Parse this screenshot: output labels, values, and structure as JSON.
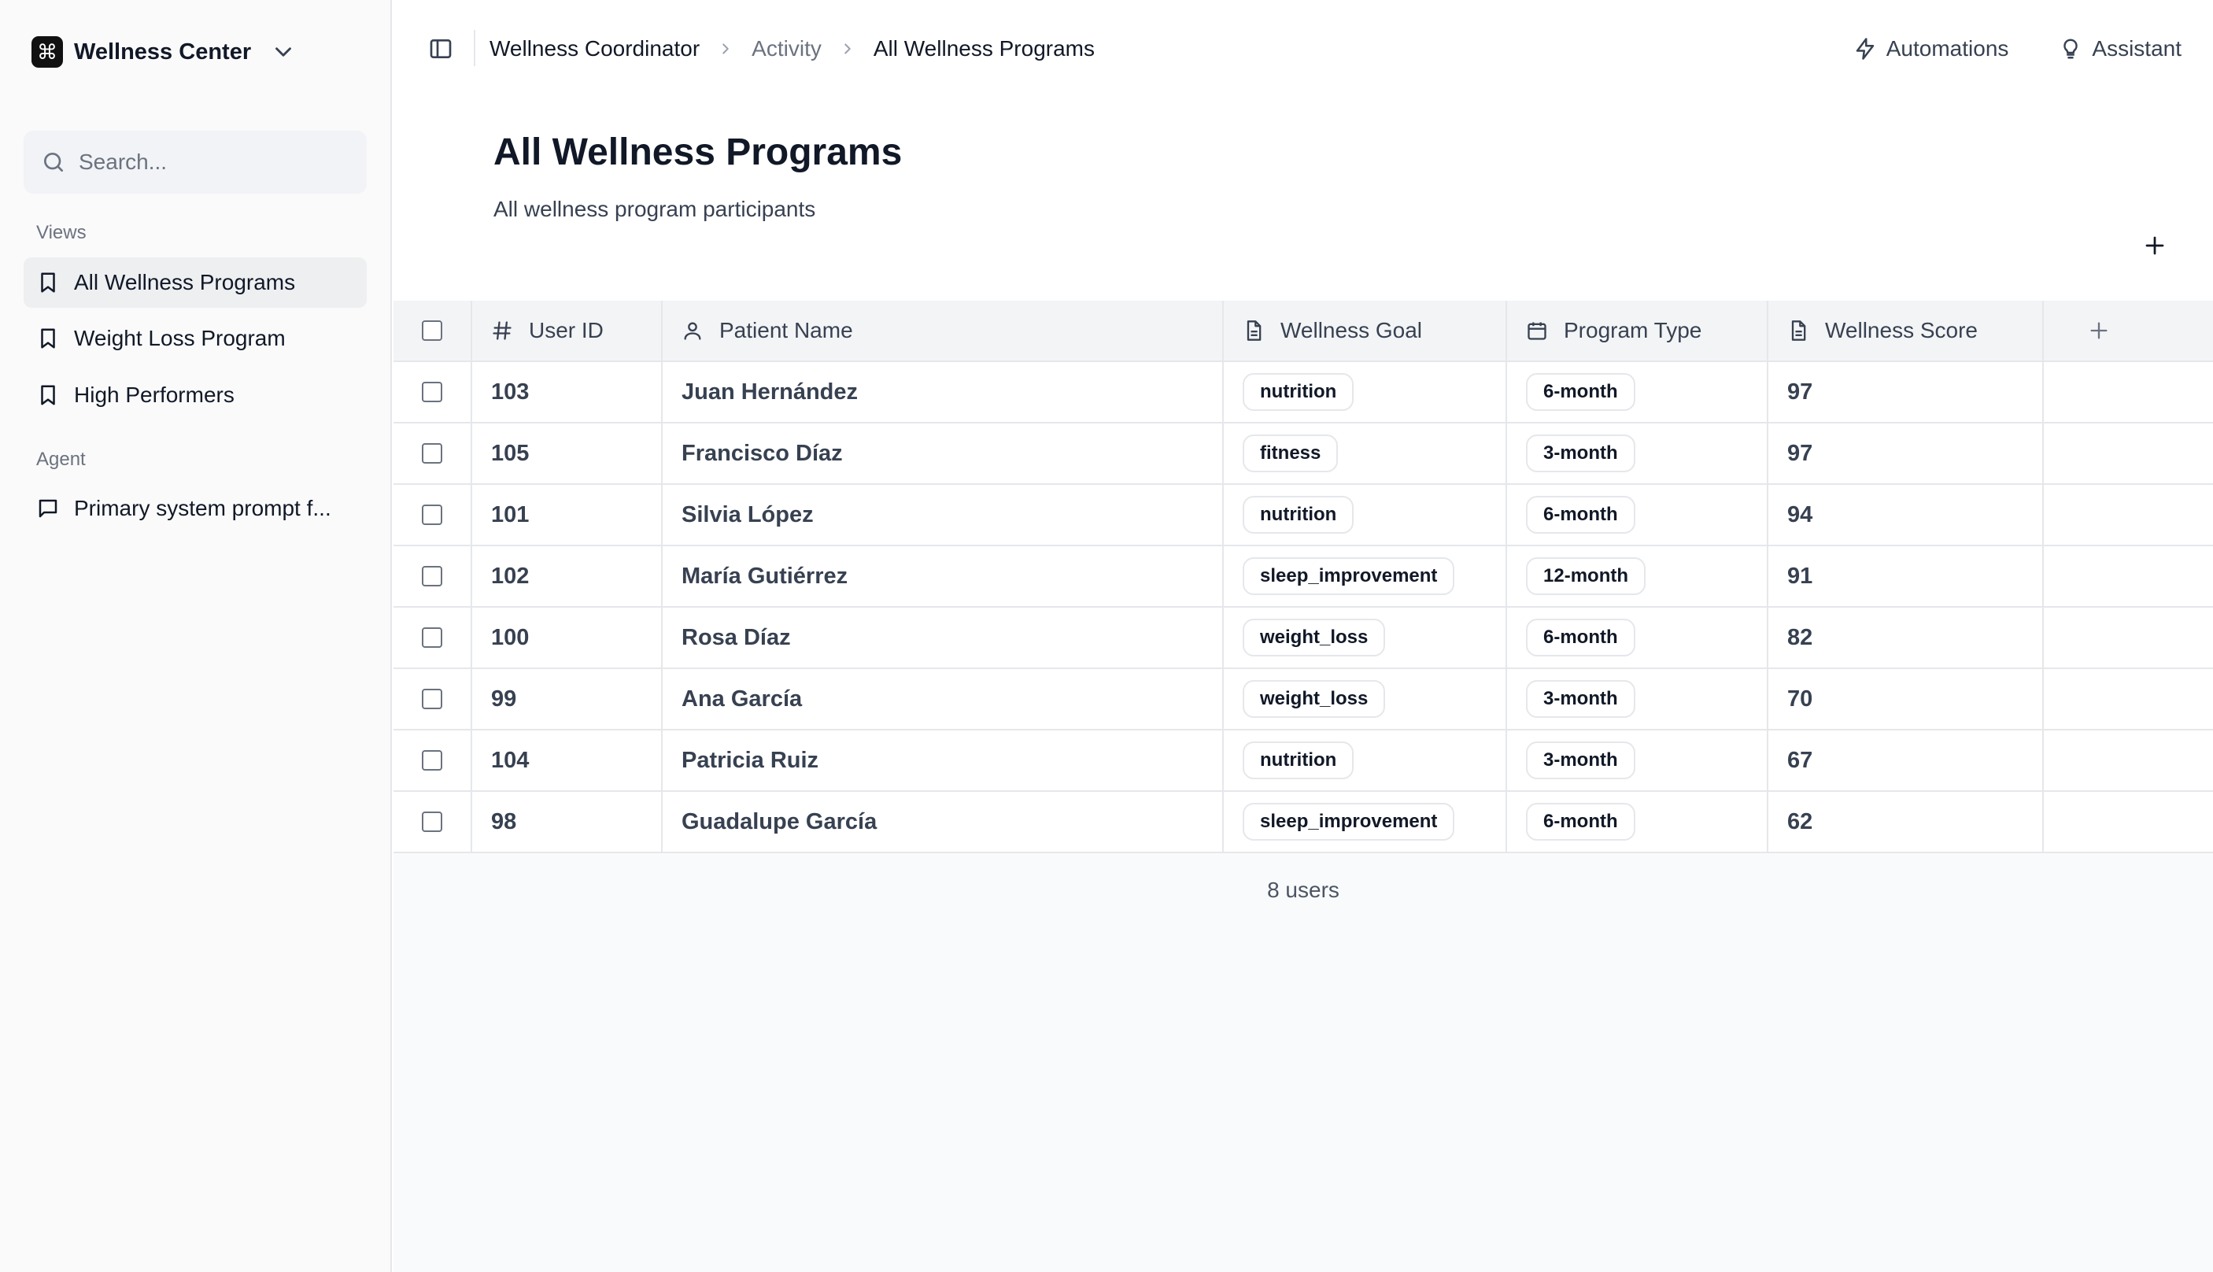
{
  "app": {
    "workspace_name": "Wellness Center",
    "logo_glyph": "⌘"
  },
  "sidebar": {
    "search_placeholder": "Search...",
    "views_label": "Views",
    "views": [
      {
        "label": "All Wellness Programs",
        "icon": "bookmark-icon",
        "active": true
      },
      {
        "label": "Weight Loss Program",
        "icon": "bookmark-icon",
        "active": false
      },
      {
        "label": "High Performers",
        "icon": "bookmark-icon",
        "active": false
      }
    ],
    "agent_label": "Agent",
    "agent_items": [
      {
        "label": "Primary system prompt f...",
        "icon": "chat-bubble-icon"
      }
    ]
  },
  "topbar": {
    "breadcrumbs": [
      "Wellness Coordinator",
      "Activity",
      "All Wellness Programs"
    ],
    "automations_label": "Automations",
    "assistant_label": "Assistant"
  },
  "page": {
    "title": "All Wellness Programs",
    "subtitle": "All wellness program participants"
  },
  "table": {
    "columns": {
      "user_id": {
        "label": "User ID",
        "icon": "hash-icon"
      },
      "patient_name": {
        "label": "Patient Name",
        "icon": "user-icon"
      },
      "wellness_goal": {
        "label": "Wellness Goal",
        "icon": "document-icon"
      },
      "program_type": {
        "label": "Program Type",
        "icon": "calendar-icon"
      },
      "wellness_score": {
        "label": "Wellness Score",
        "icon": "document-icon"
      }
    },
    "rows": [
      {
        "user_id": "103",
        "patient_name": "Juan Hernández",
        "wellness_goal": "nutrition",
        "program_type": "6-month",
        "wellness_score": "97"
      },
      {
        "user_id": "105",
        "patient_name": "Francisco Díaz",
        "wellness_goal": "fitness",
        "program_type": "3-month",
        "wellness_score": "97"
      },
      {
        "user_id": "101",
        "patient_name": "Silvia López",
        "wellness_goal": "nutrition",
        "program_type": "6-month",
        "wellness_score": "94"
      },
      {
        "user_id": "102",
        "patient_name": "María Gutiérrez",
        "wellness_goal": "sleep_improvement",
        "program_type": "12-month",
        "wellness_score": "91"
      },
      {
        "user_id": "100",
        "patient_name": "Rosa Díaz",
        "wellness_goal": "weight_loss",
        "program_type": "6-month",
        "wellness_score": "82"
      },
      {
        "user_id": "99",
        "patient_name": "Ana García",
        "wellness_goal": "weight_loss",
        "program_type": "3-month",
        "wellness_score": "70"
      },
      {
        "user_id": "104",
        "patient_name": "Patricia Ruiz",
        "wellness_goal": "nutrition",
        "program_type": "3-month",
        "wellness_score": "67"
      },
      {
        "user_id": "98",
        "patient_name": "Guadalupe García",
        "wellness_goal": "sleep_improvement",
        "program_type": "6-month",
        "wellness_score": "62"
      }
    ],
    "footer_count": "8 users"
  },
  "colors": {
    "accent_dark": "#111111",
    "sidebar_bg": "#fafafa",
    "header_bg": "#f3f4f6",
    "border": "#e5e7eb"
  }
}
